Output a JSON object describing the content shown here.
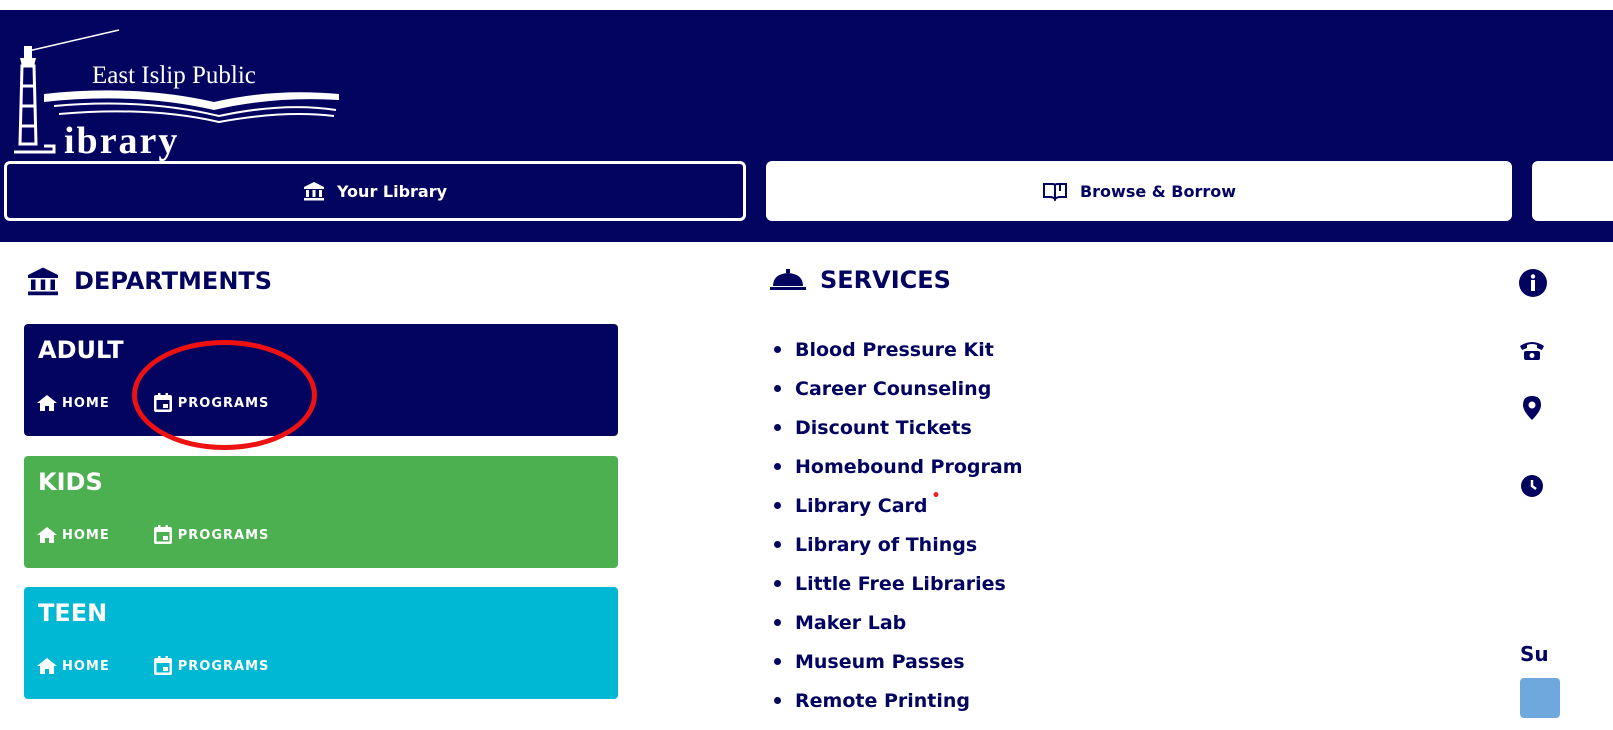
{
  "header": {
    "logo_line1": "East Islip Public",
    "logo_line2": "ibrary"
  },
  "nav": {
    "tabs": [
      {
        "label": "Your Library",
        "icon": "bank-icon"
      },
      {
        "label": "Browse & Borrow",
        "icon": "book-icon"
      }
    ]
  },
  "departments": {
    "title": "DEPARTMENTS",
    "cards": [
      {
        "name": "ADULT",
        "home": "HOME",
        "programs": "PROGRAMS",
        "color": "#030360"
      },
      {
        "name": "KIDS",
        "home": "HOME",
        "programs": "PROGRAMS",
        "color": "#4caf50"
      },
      {
        "name": "TEEN",
        "home": "HOME",
        "programs": "PROGRAMS",
        "color": "#00b8d4"
      }
    ]
  },
  "services": {
    "title": "SERVICES",
    "items": [
      "Blood Pressure Kit",
      "Career Counseling",
      "Discount Tickets",
      "Homebound Program",
      "Library Card",
      "Library of Things",
      "Little Free Libraries",
      "Maker Lab",
      "Museum Passes",
      "Remote Printing"
    ]
  },
  "right_column": {
    "partial_heading": "Su"
  },
  "colors": {
    "navy": "#030360",
    "kids": "#4caf50",
    "teen": "#00b8d4",
    "annotation": "#ee1111"
  }
}
